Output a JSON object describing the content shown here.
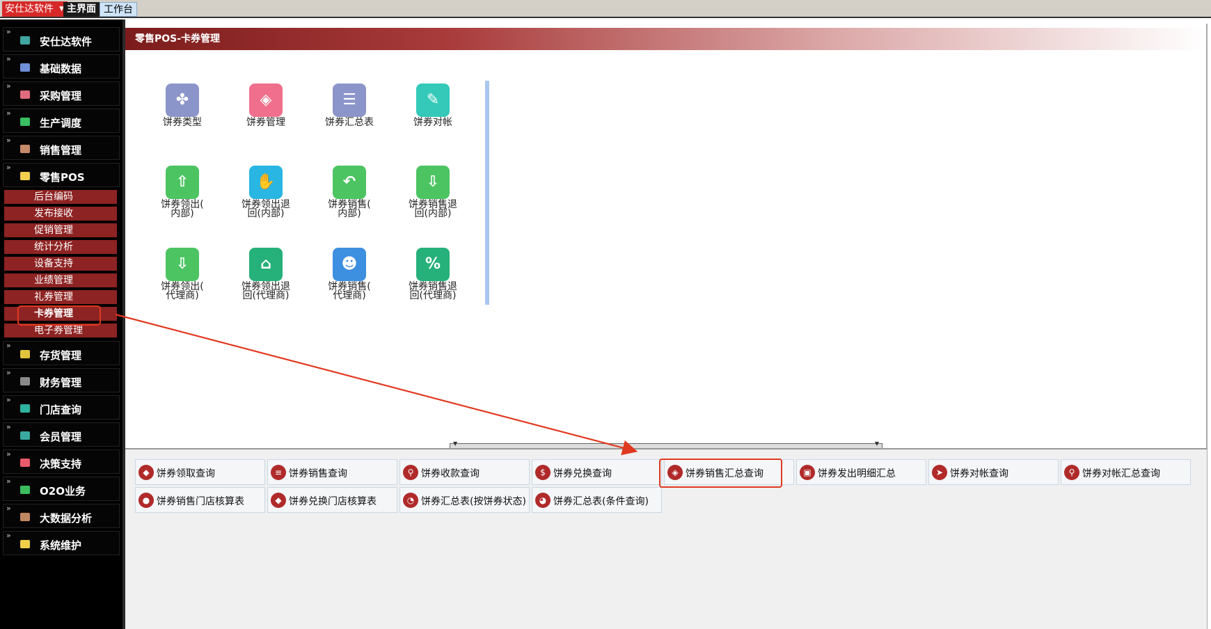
{
  "topbar": {
    "app_menu": "安仕达软件",
    "tabs": [
      {
        "label": "主界面",
        "active": true
      },
      {
        "label": "工作台",
        "active": false
      }
    ]
  },
  "sidebar": {
    "items_top": [
      {
        "label": "安仕达软件",
        "icon_color": "#3fa6a0"
      },
      {
        "label": "基础数据",
        "icon_color": "#6f8fd8"
      },
      {
        "label": "采购管理",
        "icon_color": "#e06b7d"
      },
      {
        "label": "生产调度",
        "icon_color": "#38c061"
      },
      {
        "label": "销售管理",
        "icon_color": "#c68a6a"
      },
      {
        "label": "零售POS",
        "icon_color": "#f2cf4f"
      }
    ],
    "sub_items": [
      {
        "label": "后台编码"
      },
      {
        "label": "发布接收"
      },
      {
        "label": "促销管理"
      },
      {
        "label": "统计分析"
      },
      {
        "label": "设备支持"
      },
      {
        "label": "业绩管理"
      },
      {
        "label": "礼券管理"
      },
      {
        "label": "卡券管理",
        "selected": true
      },
      {
        "label": "电子券管理"
      }
    ],
    "items_bottom": [
      {
        "label": "存货管理",
        "icon_color": "#e0c43c"
      },
      {
        "label": "财务管理",
        "icon_color": "#8a8a8a"
      },
      {
        "label": "门店查询",
        "icon_color": "#2eb3a0"
      },
      {
        "label": "会员管理",
        "icon_color": "#3aa8a0"
      },
      {
        "label": "决策支持",
        "icon_color": "#e85a6a"
      },
      {
        "label": "O2O业务",
        "icon_color": "#3bbd5e"
      },
      {
        "label": "大数据分析",
        "icon_color": "#c08860"
      },
      {
        "label": "系统维护",
        "icon_color": "#f0d04a"
      }
    ]
  },
  "panel": {
    "title": "零售POS-卡券管理"
  },
  "tiles": [
    {
      "label": "饼券类型",
      "color": "#8c95c9",
      "glyph": "✤"
    },
    {
      "label": "饼券管理",
      "color": "#ef6f8c",
      "glyph": "◈"
    },
    {
      "label": "饼券汇总表",
      "color": "#8c95c9",
      "glyph": "☰"
    },
    {
      "label": "饼券对帐",
      "color": "#34c9b8",
      "glyph": "✎"
    },
    {
      "label": "饼券领出(\n内部)",
      "color": "#4cc462",
      "glyph": "⇧"
    },
    {
      "label": "饼券领出退\n回(内部)",
      "color": "#29b6e3",
      "glyph": "✋"
    },
    {
      "label": "饼券销售(\n内部)",
      "color": "#4cc462",
      "glyph": "↶"
    },
    {
      "label": "饼券销售退\n回(内部)",
      "color": "#4cc462",
      "glyph": "⇩"
    },
    {
      "label": "饼券领出(\n代理商)",
      "color": "#4cc462",
      "glyph": "⇩"
    },
    {
      "label": "饼券领出退\n回(代理商)",
      "color": "#26b07a",
      "glyph": "⌂"
    },
    {
      "label": "饼券销售(\n代理商)",
      "color": "#3d8fe0",
      "glyph": "☻"
    },
    {
      "label": "饼券销售退\n回(代理商)",
      "color": "#26b07a",
      "glyph": "%"
    }
  ],
  "queries": [
    {
      "label": "饼券领取查询",
      "glyph": "◆"
    },
    {
      "label": "饼券销售查询",
      "glyph": "≡"
    },
    {
      "label": "饼券收款查询",
      "glyph": "⚲"
    },
    {
      "label": "饼券兑换查询",
      "glyph": "$"
    },
    {
      "label": "饼券销售汇总查询",
      "glyph": "◈",
      "highlighted": true
    },
    {
      "label": "饼券发出明细汇总",
      "glyph": "▣"
    },
    {
      "label": "饼券对帐查询",
      "glyph": "➤"
    },
    {
      "label": "饼券对帐汇总查询",
      "glyph": "⚲"
    },
    {
      "label": "饼券销售门店核算表",
      "glyph": "●"
    },
    {
      "label": "饼券兑换门店核算表",
      "glyph": "◆"
    },
    {
      "label": "饼券汇总表(按饼券状态)",
      "glyph": "◔"
    },
    {
      "label": "饼券汇总表(条件查询)",
      "glyph": "◕"
    }
  ],
  "colors": {
    "accent_red": "#8e2323",
    "annotation_red": "#e0391f"
  }
}
